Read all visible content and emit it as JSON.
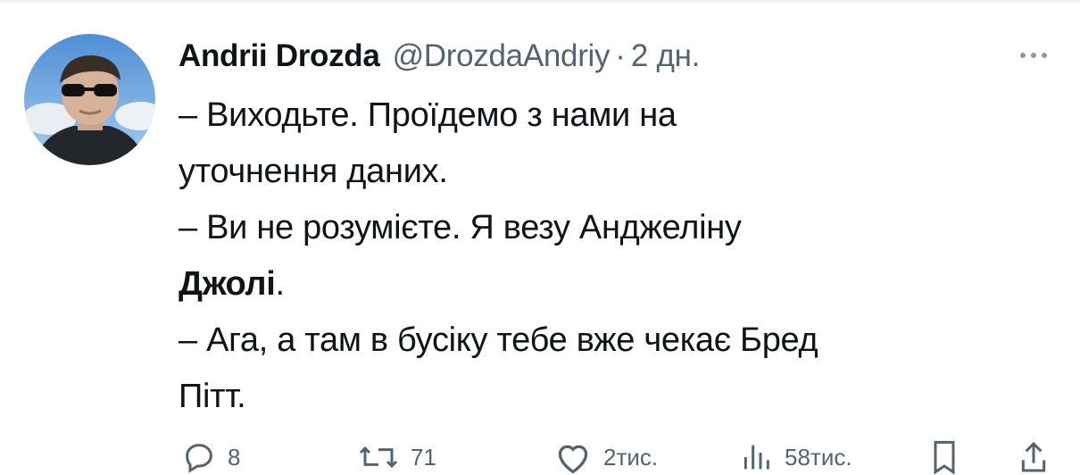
{
  "tweet": {
    "author_name": "Andrii Drozda",
    "handle": "@DrozdaAndriy",
    "separator": "·",
    "time": "2 дн.",
    "more_icon": "more-horizontal-icon",
    "lines": [
      "– Виходьте. Проїдемо з нами на",
      "уточнення даних.",
      "– Ви не розумієте. Я везу Анджеліну"
    ],
    "line_bold": "Джолі",
    "line_bold_suffix": ".",
    "lines_after": [
      "– Ага, а там в бусіку тебе вже чекає Бред",
      "Пітт."
    ]
  },
  "actions": {
    "reply": {
      "icon": "reply-icon",
      "count": "8"
    },
    "retweet": {
      "icon": "retweet-icon",
      "count": "71"
    },
    "like": {
      "icon": "heart-icon",
      "count": "2тис."
    },
    "views": {
      "icon": "views-icon",
      "count": "58тис."
    },
    "bookmark": {
      "icon": "bookmark-icon"
    },
    "share": {
      "icon": "share-icon"
    }
  },
  "colors": {
    "text": "#0f1419",
    "secondary": "#536471",
    "border": "#eff3f4"
  }
}
